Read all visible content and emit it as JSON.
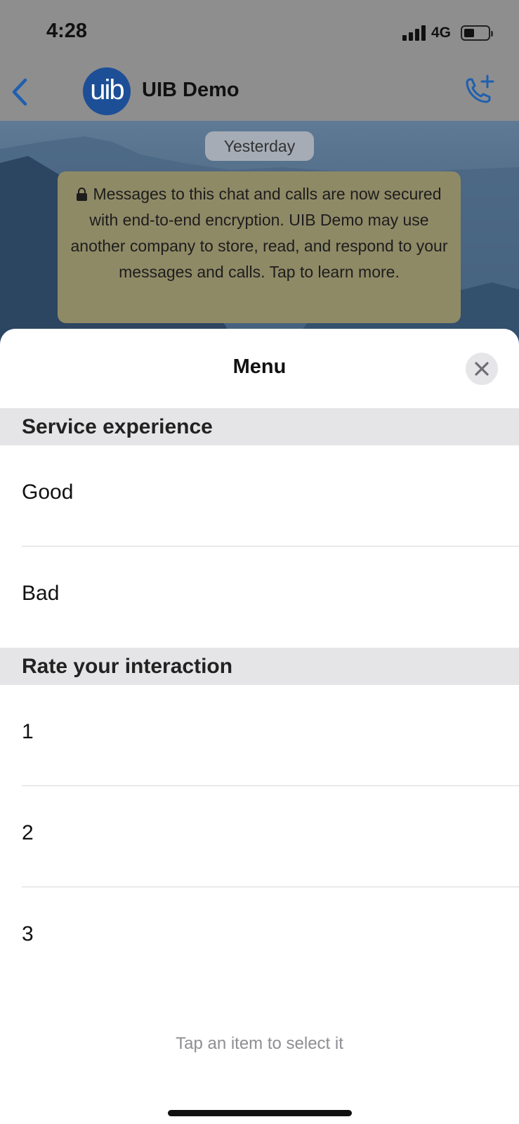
{
  "status_bar": {
    "time": "4:28",
    "network": "4G"
  },
  "chat": {
    "title": "UIB Demo",
    "avatar_text": "uib",
    "date_chip": "Yesterday",
    "encryption_notice": "Messages to this chat and calls are now secured with end-to-end encryption. UIB Demo may use another company to store, read, and respond to your messages and calls. Tap to learn more."
  },
  "menu": {
    "title": "Menu",
    "sections": [
      {
        "header": "Service experience",
        "options": [
          "Good",
          "Bad"
        ]
      },
      {
        "header": "Rate your interaction",
        "options": [
          "1",
          "2",
          "3"
        ]
      }
    ],
    "hint": "Tap an item to select it"
  },
  "colors": {
    "accent": "#1d4f97",
    "section_bg": "#e5e5e7",
    "notice_bg": "#8f8a66"
  },
  "icons": [
    "back-chevron-icon",
    "call-add-icon",
    "lock-icon",
    "close-icon",
    "signal-icon",
    "battery-icon"
  ]
}
